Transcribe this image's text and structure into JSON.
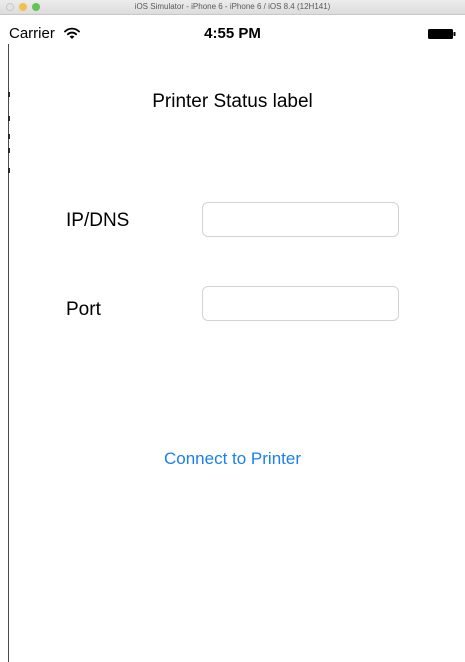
{
  "window": {
    "title": "iOS Simulator - iPhone 6 - iPhone 6 / iOS 8.4 (12H141)"
  },
  "status_bar": {
    "carrier": "Carrier",
    "time": "4:55 PM",
    "icons": [
      "wifi-icon",
      "battery-icon"
    ]
  },
  "main": {
    "status_label": "Printer Status label",
    "ip_label": "IP/DNS",
    "ip_value": "",
    "port_label": "Port",
    "port_value": "",
    "connect_label": "Connect to Printer"
  },
  "colors": {
    "accent": "#1a7ff2",
    "background": "#ffffff",
    "text": "#000000",
    "field_border": "#d3d3d3"
  }
}
